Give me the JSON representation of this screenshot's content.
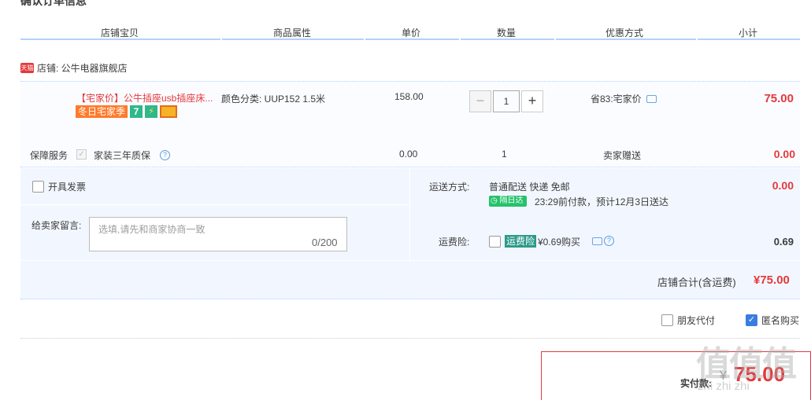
{
  "page_title": "确认订单信息",
  "columns": [
    "店铺宝贝",
    "商品属性",
    "单价",
    "数量",
    "优惠方式",
    "小计"
  ],
  "shop": {
    "badge": "天猫",
    "label": "店铺: 公牛电器旗舰店"
  },
  "item": {
    "title": "【宅家价】公牛插座usb插座床...",
    "tags": {
      "winter": "冬日宅家季",
      "seven": "7"
    },
    "attribute": "颜色分类: UUP152 1.5米",
    "price": "158.00",
    "qty_minus": "−",
    "qty": "1",
    "qty_plus": "+",
    "promo": "省83:宅家价",
    "subtotal": "75.00"
  },
  "service": {
    "label": "保障服务",
    "check": "✓",
    "name": "家装三年质保",
    "help": "?",
    "price": "0.00",
    "qty": "1",
    "gift": "卖家赠送",
    "total": "0.00"
  },
  "invoice_label": "开具发票",
  "message": {
    "label": "给卖家留言:",
    "placeholder": "选填,请先和商家协商一致",
    "count": "0/200"
  },
  "shipping": {
    "label": "运送方式:",
    "value": "普通配送 快递 免邮",
    "tag": "隔日达",
    "time": "23:29前付款，预计12月3日送达",
    "cost": "0.00"
  },
  "insurance": {
    "label": "运费险:",
    "tag": "运费险",
    "price": "¥0.69购买",
    "help": "?",
    "total": "0.69"
  },
  "shop_total": {
    "label": "店铺合计(含运费)",
    "value": "¥75.00"
  },
  "options": {
    "friend_pay": "朋友代付",
    "anonymous": "匿名购买",
    "anonymous_check": "✓"
  },
  "payment": {
    "label": "实付款:",
    "currency": "¥",
    "value": "75.00"
  },
  "watermark": {
    "main": "值值值",
    "sub": "zhi zhi zhi"
  }
}
